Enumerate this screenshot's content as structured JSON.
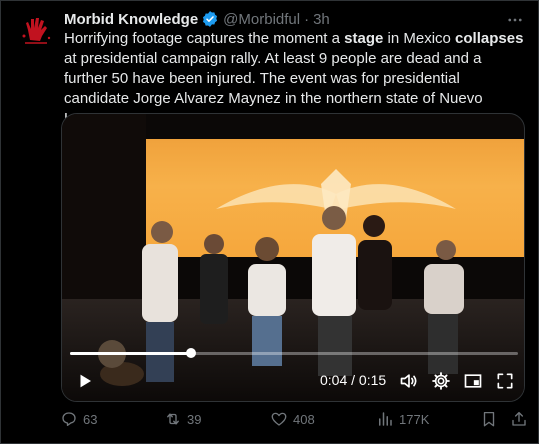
{
  "post": {
    "author_name": "Morbid Knowledge",
    "handle": "@Morbidful",
    "separator": "·",
    "time": "3h",
    "text_parts": [
      "Horrifying footage captures the moment a ",
      "stage",
      " in Mexico ",
      "collapses",
      " at presidential campaign rally. At least 9 people are dead and a further 50 have been injured. The event was for presidential candidate Jorge Alvarez Maynez in the northern state of Nuevo Leon."
    ]
  },
  "video": {
    "current_time": "0:04",
    "time_divider": " / ",
    "duration": "0:15",
    "progress": 0.27
  },
  "actions": {
    "replies": "63",
    "reposts": "39",
    "likes": "408",
    "views": "177K"
  },
  "icons": {
    "avatar": "hand-print-avatar",
    "verified": "verified-badge-icon",
    "more": "more-options-icon",
    "play": "play-icon",
    "volume": "volume-icon",
    "settings": "settings-gear-icon",
    "pip": "picture-in-picture-icon",
    "fullscreen": "fullscreen-icon",
    "reply": "reply-icon",
    "repost": "repost-icon",
    "like": "like-heart-icon",
    "views": "views-chart-icon",
    "bookmark": "bookmark-icon",
    "share": "share-icon"
  },
  "colors": {
    "background": "#000000",
    "text": "#e7e9ea",
    "secondary": "#71767b",
    "verified": "#1d9bf0",
    "avatar_red": "#c1121f"
  }
}
